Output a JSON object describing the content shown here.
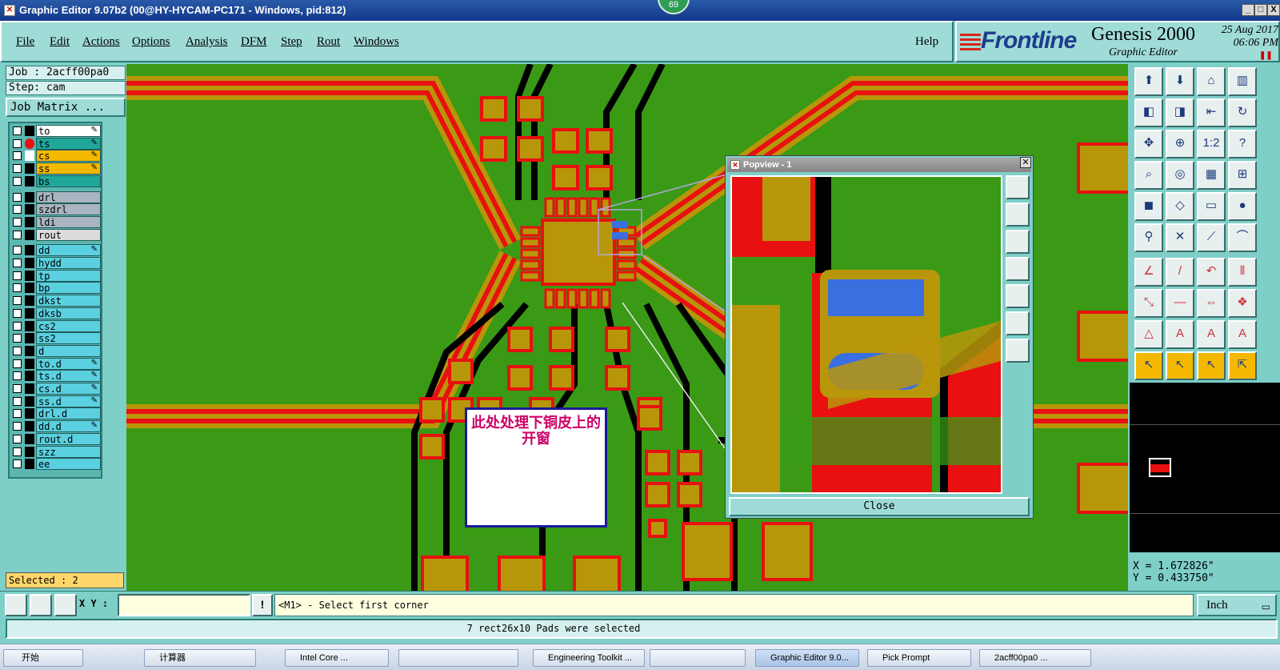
{
  "titlebar": {
    "title": "Graphic Editor 9.07b2 (00@HY-HYCAM-PC171 - Windows, pid:812)",
    "minimize": "_",
    "maximize": "□",
    "close": "X"
  },
  "notification_badge": "69",
  "menu": {
    "items": [
      "File",
      "Edit",
      "Actions",
      "Options",
      "Analysis",
      "DFM",
      "Step",
      "Rout",
      "Windows"
    ],
    "help": "Help"
  },
  "brand": {
    "logo": "Frontline",
    "product": "Genesis 2000",
    "subtitle": "Graphic Editor",
    "date": "25 Aug 2017",
    "time": "06:06 PM"
  },
  "job": {
    "job_line": "Job : 2acff00pa0",
    "step_line": "Step: cam",
    "matrix_button": "Job Matrix ..."
  },
  "layers": [
    {
      "name": "to",
      "color": "#ffffff",
      "ind": "#000000",
      "edit": true
    },
    {
      "name": "ts",
      "color": "#1fa89a",
      "ind": "#e81010",
      "edit": true
    },
    {
      "name": "cs",
      "color": "#f5b800",
      "ind": "#ffffff",
      "edit": true
    },
    {
      "name": "ss",
      "color": "#f5b800",
      "ind": "#000000",
      "edit": true
    },
    {
      "name": "bs",
      "color": "#1fa89a",
      "ind": "#000000",
      "edit": false
    },
    {
      "name": "drl",
      "color": "#a8b4c0",
      "ind": "#000000",
      "edit": false
    },
    {
      "name": "szdrl",
      "color": "#a8b4c0",
      "ind": "#000000",
      "edit": false
    },
    {
      "name": "ldi",
      "color": "#a8b4c0",
      "ind": "#000000",
      "edit": false
    },
    {
      "name": "rout",
      "color": "#dcdcdc",
      "ind": "#000000",
      "edit": false
    },
    {
      "name": "dd",
      "color": "#5ad0e0",
      "ind": "#000000",
      "edit": true
    },
    {
      "name": "hydd",
      "color": "#5ad0e0",
      "ind": "#000000",
      "edit": false
    },
    {
      "name": "tp",
      "color": "#5ad0e0",
      "ind": "#000000",
      "edit": false
    },
    {
      "name": "bp",
      "color": "#5ad0e0",
      "ind": "#000000",
      "edit": false
    },
    {
      "name": "dkst",
      "color": "#5ad0e0",
      "ind": "#000000",
      "edit": false
    },
    {
      "name": "dksb",
      "color": "#5ad0e0",
      "ind": "#000000",
      "edit": false
    },
    {
      "name": "cs2",
      "color": "#5ad0e0",
      "ind": "#000000",
      "edit": false
    },
    {
      "name": "ss2",
      "color": "#5ad0e0",
      "ind": "#000000",
      "edit": false
    },
    {
      "name": "d",
      "color": "#5ad0e0",
      "ind": "#000000",
      "edit": false
    },
    {
      "name": "to.d",
      "color": "#5ad0e0",
      "ind": "#000000",
      "edit": true
    },
    {
      "name": "ts.d",
      "color": "#5ad0e0",
      "ind": "#000000",
      "edit": true
    },
    {
      "name": "cs.d",
      "color": "#5ad0e0",
      "ind": "#000000",
      "edit": true
    },
    {
      "name": "ss.d",
      "color": "#5ad0e0",
      "ind": "#000000",
      "edit": true
    },
    {
      "name": "drl.d",
      "color": "#5ad0e0",
      "ind": "#000000",
      "edit": false
    },
    {
      "name": "dd.d",
      "color": "#5ad0e0",
      "ind": "#000000",
      "edit": true
    },
    {
      "name": "rout.d",
      "color": "#5ad0e0",
      "ind": "#000000",
      "edit": false
    },
    {
      "name": "szz",
      "color": "#5ad0e0",
      "ind": "#000000",
      "edit": false
    },
    {
      "name": "ee",
      "color": "#5ad0e0",
      "ind": "#000000",
      "edit": false
    }
  ],
  "selected_count": "Selected : 2",
  "popview": {
    "title": "Popview - 1",
    "close_label": "Close"
  },
  "annotation": "此处处理下铜皮上的开窗",
  "coords": {
    "x": "X =  1.672826\"",
    "y": "Y =  0.433750\""
  },
  "toolbar_icons": [
    "zoom-home-icon",
    "zoom-in-icon",
    "home-icon",
    "zoom-window-icon",
    "pan-left-icon",
    "pan-right-icon",
    "zoom-back-icon",
    "redraw-icon",
    "fit-icon",
    "center-icon",
    "scale-icon",
    "help-icon",
    "measure-icon",
    "snap-icon",
    "layers-icon",
    "net-icon",
    "pad-icon",
    "shape-icon",
    "ruler-icon",
    "circle-icon",
    "connect-icon",
    "cross-icon",
    "line-icon",
    "arc-icon",
    "edit-line-icon",
    "slash-icon",
    "undo-arc-icon",
    "split-icon",
    "transform-icon",
    "minus-icon",
    "resize-icon",
    "group-icon",
    "triangle-icon",
    "text-a-icon",
    "text-outline-icon",
    "text-bold-icon",
    "select-arrow-icon",
    "select-box-icon",
    "select-circle-icon",
    "select-net-icon"
  ],
  "command": {
    "xy_label": "X Y :",
    "xy_value": "",
    "prompt": "<M1> - Select first corner",
    "unit": "Inch"
  },
  "status_message": "7 rect26x10 Pads were selected",
  "taskbar": {
    "start": "开始",
    "items": [
      "计算器",
      "Intel Core ...",
      "",
      "Engineering Toolkit ...",
      "",
      "Graphic Editor 9.0...",
      "Pick Prompt",
      "2acff00pa0 ..."
    ]
  },
  "colors": {
    "board": "#3a9a16",
    "copper": "#b8960a",
    "mask": "#e81010",
    "void": "#000000",
    "highlight": "#3a6fe0",
    "accent": "#2f7a76"
  }
}
